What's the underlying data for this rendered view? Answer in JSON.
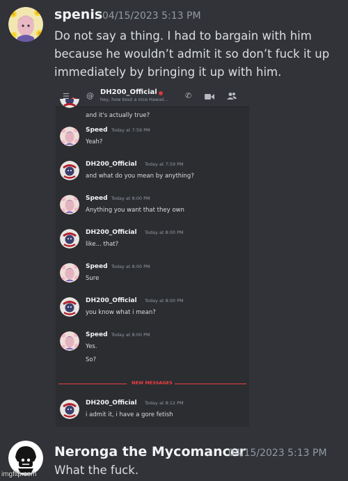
{
  "messages": [
    {
      "username": "spenis",
      "timestamp": "04/15/2023 5:13 PM",
      "lines": [
        "Do not say a thing. I had to bargain with him",
        "because he wouldn’t admit it so don’t fuck it up",
        "immediately by bringing it up with him."
      ]
    },
    {
      "username": "Neronga the Mycomancer",
      "timestamp": "04/15/2023 5:13 PM",
      "lines": [
        "What the fuck."
      ]
    }
  ],
  "screenshot": {
    "header": {
      "channel_name": "DH200_Official",
      "status": "hey, how bout a nice Hawaii...",
      "badge_count": "1"
    },
    "partial_top_text": "and it's actually true?",
    "chat": [
      {
        "name": "Speed",
        "time": "Today at 7:59 PM",
        "lines": [
          "Yeah?"
        ]
      },
      {
        "name": "DH200_Official",
        "time": "Today at 7:59 PM",
        "lines": [
          "and what do you mean by anything?"
        ]
      },
      {
        "name": "Speed",
        "time": "Today at 8:00 PM",
        "lines": [
          "Anything you want that they own"
        ]
      },
      {
        "name": "DH200_Official",
        "time": "Today at 8:00 PM",
        "lines": [
          "like... that?"
        ]
      },
      {
        "name": "Speed",
        "time": "Today at 8:00 PM",
        "lines": [
          "Sure"
        ]
      },
      {
        "name": "DH200_Official",
        "time": "Today at 8:00 PM",
        "lines": [
          "you know what i mean?"
        ]
      },
      {
        "name": "Speed",
        "time": "Today at 8:00 PM",
        "lines": [
          "Yes.",
          "So?"
        ]
      },
      {
        "name": "DH200_Official",
        "time": "Today at 8:12 PM",
        "lines": [
          "i admit it, i have a gore fetish"
        ]
      }
    ],
    "new_messages_label": "NEW MESSAGES"
  },
  "watermark": "imgflip.com",
  "colors": {
    "background": "#313338",
    "new_messages": "#f23f43",
    "username": "#f2f3f5",
    "timestamp": "#949ba4"
  }
}
